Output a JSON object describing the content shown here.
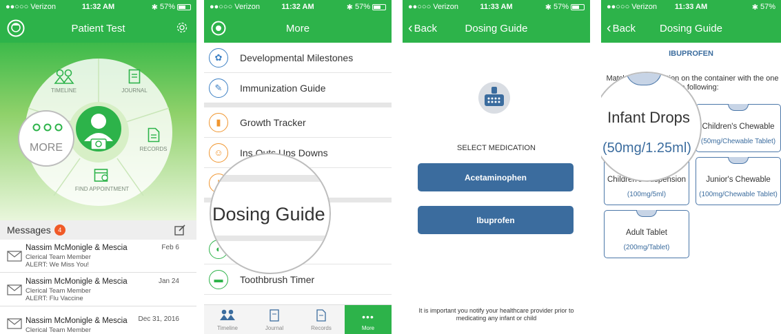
{
  "status": {
    "carrier": "●●○○○ Verizon",
    "battery": "57%",
    "time1": "11:32 AM",
    "time2": "11:32 AM",
    "time3": "11:33 AM",
    "time4": "11:33 AM"
  },
  "screen1": {
    "title": "Patient Test",
    "wheel": {
      "timeline": "TIMELINE",
      "journal": "JOURNAL",
      "records": "RECORDS",
      "find_appointment": "FIND APPOINTMENT",
      "more": "MORE"
    },
    "messages_label": "Messages",
    "messages_count": "4",
    "messages": [
      {
        "from": "Nassim McMonigle & Mescia",
        "role": "Clerical Team Member",
        "alert": "ALERT: We Miss You!",
        "date": "Feb 6"
      },
      {
        "from": "Nassim McMonigle & Mescia",
        "role": "Clerical Team Member",
        "alert": "ALERT: Flu Vaccine",
        "date": "Jan 24"
      },
      {
        "from": "Nassim McMonigle & Mescia",
        "role": "Clerical Team Member",
        "alert": "",
        "date": "Dec 31, 2016"
      }
    ]
  },
  "screen2": {
    "title": "More",
    "items": [
      {
        "label": "Developmental Milestones"
      },
      {
        "label": "Immunization Guide"
      },
      {
        "label": "Growth Tracker"
      },
      {
        "label": "Ins Outs Ups Downs"
      },
      {
        "label": "Toothbrush Timer"
      }
    ],
    "magnified_label": "Dosing Guide",
    "tabs": [
      {
        "label": "Timeline"
      },
      {
        "label": "Journal"
      },
      {
        "label": "Records"
      },
      {
        "label": "More"
      }
    ],
    "colors": {
      "accent": "#2db34a",
      "item_blue": "#3b7fc4",
      "item_orange": "#f0952e",
      "item_green": "#2db34a"
    }
  },
  "screen3": {
    "back": "Back",
    "title": "Dosing Guide",
    "select_label": "SELECT MEDICATION",
    "buttons": [
      "Acetaminophen",
      "Ibuprofen"
    ],
    "notice": "It is important you notify your healthcare provider prior to medicating any infant or child"
  },
  "screen4": {
    "back": "Back",
    "title": "Dosing Guide",
    "drug": "IBUPROFEN",
    "instruction": "Match the information on the container with the one of the following:",
    "cards": [
      {
        "name": "Infant Drops",
        "dose": "(50mg/1.25ml)"
      },
      {
        "name": "Children's Chewable",
        "dose": "(50mg/Chewable Tablet)"
      },
      {
        "name": "Children's Suspension",
        "dose": "(100mg/5ml)"
      },
      {
        "name": "Junior's Chewable",
        "dose": "(100mg/Chewable Tablet)"
      },
      {
        "name": "Adult Tablet",
        "dose": "(200mg/Tablet)"
      }
    ],
    "magnified": {
      "name": "Infant Drops",
      "dose": "(50mg/1.25ml)"
    }
  },
  "brand_green": "#2db34a",
  "button_blue": "#3b6c9e"
}
